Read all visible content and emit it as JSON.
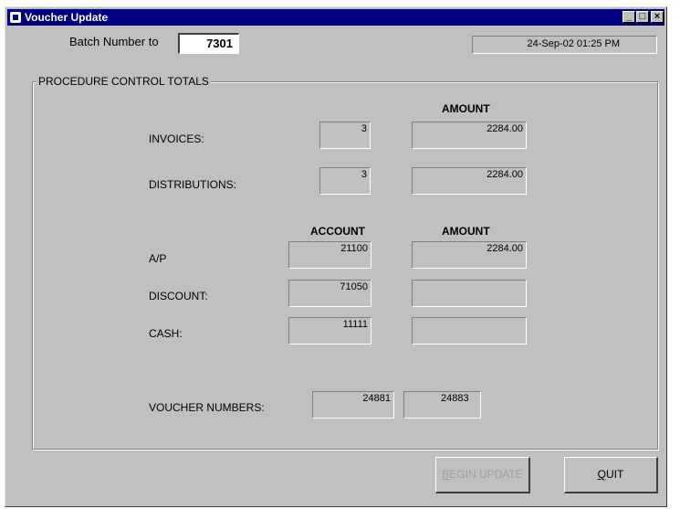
{
  "window": {
    "title": "Voucher Update"
  },
  "header": {
    "batch_label": "Batch Number to",
    "batch_number": "7301",
    "datetime": "24-Sep-02  01:25 PM"
  },
  "group": {
    "title": "PROCEDURE CONTROL TOTALS",
    "amount_header_top": "AMOUNT",
    "account_header": "ACCOUNT",
    "amount_header_bottom": "AMOUNT",
    "invoices": {
      "label": "INVOICES:",
      "count": "3",
      "amount": "2284.00"
    },
    "distributions": {
      "label": "DISTRIBUTIONS:",
      "count": "3",
      "amount": "2284.00"
    },
    "ap": {
      "label": "A/P",
      "account": "21100",
      "amount": "2284.00"
    },
    "discount": {
      "label": "DISCOUNT:",
      "account": "71050",
      "amount": ""
    },
    "cash": {
      "label": "CASH:",
      "account": "11111",
      "amount": ""
    },
    "voucher": {
      "label": "VOUCHER NUMBERS:",
      "from": "24881",
      "to": "24883"
    }
  },
  "buttons": {
    "begin_update_first": "B",
    "begin_update_rest": "EGIN UPDATE",
    "quit_first": "Q",
    "quit_rest": "UIT"
  },
  "title_buttons": {
    "minimize": "_",
    "maximize": "□",
    "close": "×"
  }
}
